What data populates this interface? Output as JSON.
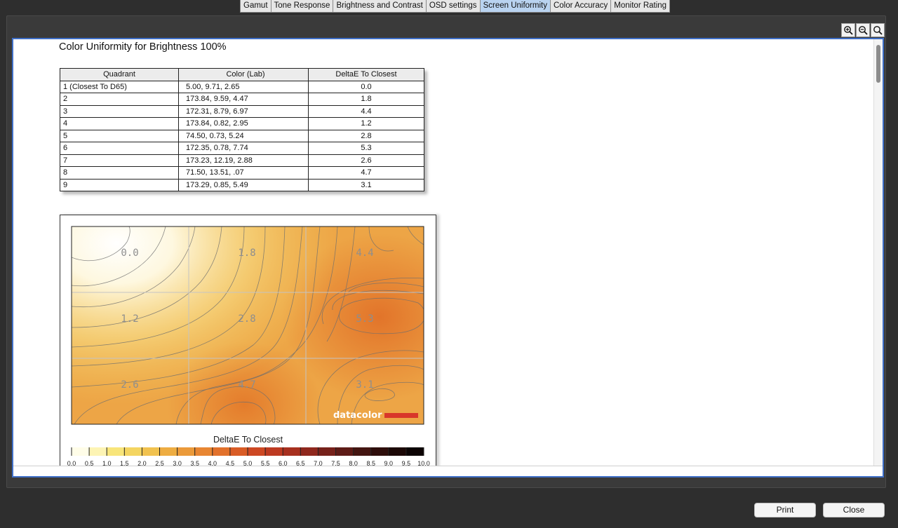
{
  "tabs": [
    "Gamut",
    "Tone Response",
    "Brightness and Contrast",
    "OSD settings",
    "Screen Uniformity",
    "Color Accuracy",
    "Monitor Rating"
  ],
  "active_tab": "Screen Uniformity",
  "zoom_icons": [
    "zoom-in-icon",
    "zoom-out-icon",
    "zoom-fit-icon"
  ],
  "report": {
    "title": "Color Uniformity for Brightness 100%",
    "table": {
      "headers": [
        "Quadrant",
        "Color (Lab)",
        "DeltaE To Closest"
      ],
      "rows": [
        [
          "1 (Closest To D65)",
          "5.00,  9.71,  2.65",
          "0.0"
        ],
        [
          "2",
          "173.84,  9.59,  4.47",
          "1.8"
        ],
        [
          "3",
          "172.31,  8.79,  6.97",
          "4.4"
        ],
        [
          "4",
          "173.84,  0.82,  2.95",
          "1.2"
        ],
        [
          "5",
          "74.50,  0.73,  5.24",
          "2.8"
        ],
        [
          "6",
          "172.35,  0.78,  7.74",
          "5.3"
        ],
        [
          "7",
          "173.23,  12.19,  2.88",
          "2.6"
        ],
        [
          "8",
          "71.50,  13.51,  .07",
          "4.7"
        ],
        [
          "9",
          "173.29,  0.85,  5.49",
          "3.1"
        ]
      ]
    },
    "uniformity_map": {
      "grid_values": [
        [
          "0.0",
          "1.8",
          "4.4"
        ],
        [
          "1.2",
          "2.8",
          "5.3"
        ],
        [
          "2.6",
          "4.7",
          "3.1"
        ]
      ],
      "watermark": "datacolor"
    },
    "scale": {
      "label": "DeltaE To Closest",
      "ticks": [
        "0.0",
        "0.5",
        "1.0",
        "1.5",
        "2.0",
        "2.5",
        "3.0",
        "3.5",
        "4.0",
        "4.5",
        "5.0",
        "5.5",
        "6.0",
        "6.5",
        "7.0",
        "7.5",
        "8.0",
        "8.5",
        "9.0",
        "9.5",
        "10.0"
      ],
      "colors": [
        "#fffde8",
        "#fdf4b4",
        "#f8e57a",
        "#f4d561",
        "#f1c24f",
        "#eead42",
        "#eb9a3a",
        "#e88632",
        "#e2712b",
        "#d95c26",
        "#cd4823",
        "#bd3a21",
        "#a7301f",
        "#8f281d",
        "#76211a",
        "#5d1b16",
        "#441511",
        "#2e0e0b",
        "#1c0806",
        "#0c0303"
      ]
    }
  },
  "buttons": {
    "print": "Print",
    "close": "Close"
  }
}
